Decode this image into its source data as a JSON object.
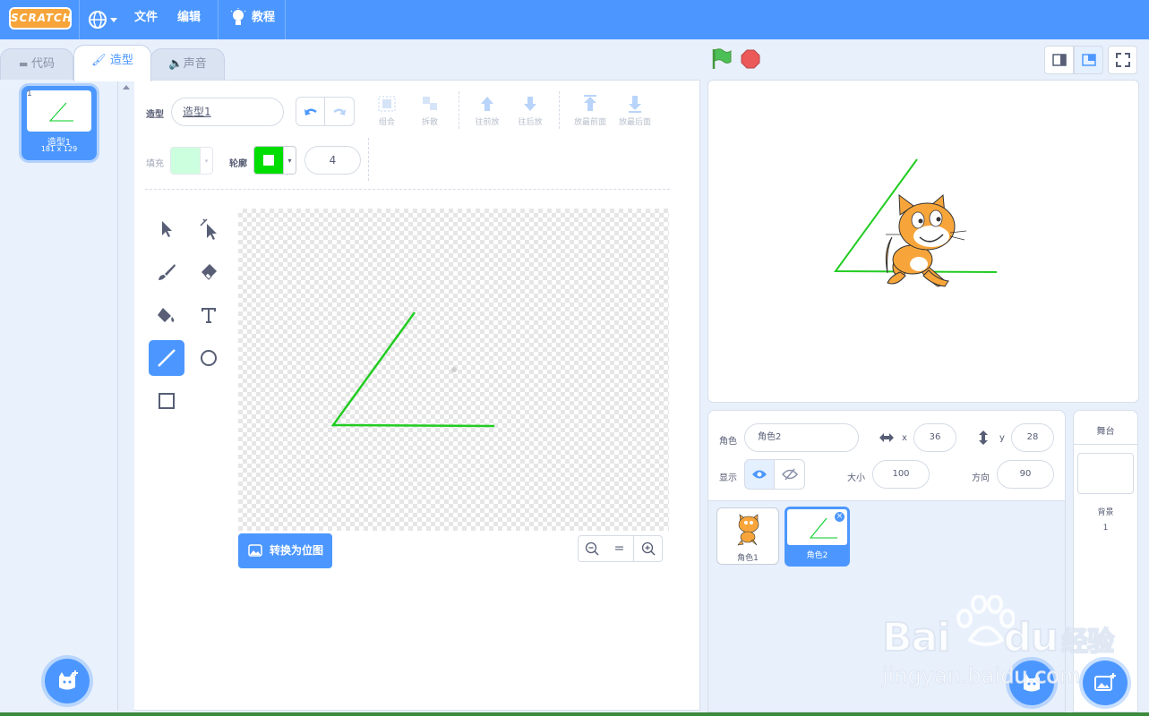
{
  "menubar": {
    "logo": "SCRATCH",
    "file": "文件",
    "edit": "编辑",
    "tutorials": "教程"
  },
  "tabs": [
    {
      "label": "代码"
    },
    {
      "label": "造型"
    },
    {
      "label": "声音"
    }
  ],
  "costume_list": {
    "items": [
      {
        "index": "1",
        "name": "造型1",
        "size": "181 x 129"
      }
    ]
  },
  "editor": {
    "costume_label": "造型",
    "costume_name": "造型1",
    "toolbar": {
      "group": "组合",
      "ungroup": "拆散",
      "forward": "往前放",
      "backward": "往后放",
      "front": "放最前面",
      "back": "放最后面"
    },
    "fill_label": "填充",
    "outline_label": "轮廓",
    "outline_width": "4",
    "fill_color": "#ccffdd",
    "outline_color": "#00dd00",
    "convert_button": "转换为位图",
    "zoom_reset": "="
  },
  "sprite_info": {
    "sprite_label": "角色",
    "sprite_name": "角色2",
    "x_label": "x",
    "x_value": "36",
    "y_label": "y",
    "y_value": "28",
    "show_label": "显示",
    "size_label": "大小",
    "size_value": "100",
    "direction_label": "方向",
    "direction_value": "90"
  },
  "sprites": [
    {
      "name": "角色1"
    },
    {
      "name": "角色2"
    }
  ],
  "stage_panel": {
    "title": "舞台",
    "backdrops_label": "背景",
    "backdrops_count": "1"
  },
  "watermark": {
    "brand": "Bai",
    "brand2": "du",
    "brand_cn": "经验",
    "url": "jingyan.baidu.com"
  },
  "colors": {
    "accent": "#4c97ff",
    "line": "#00cc22",
    "flag": "#4cbf56",
    "stop": "#ec5959"
  }
}
